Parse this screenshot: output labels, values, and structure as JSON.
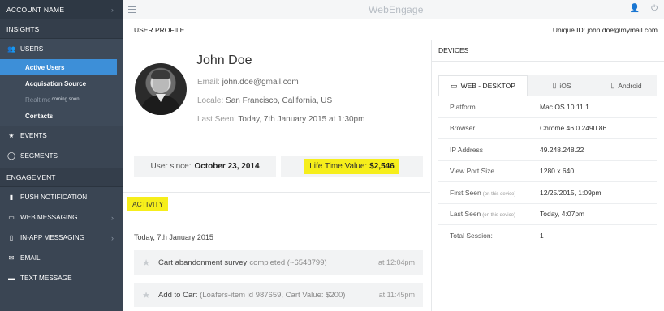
{
  "sidebar": {
    "account_name": "ACCOUNT NAME",
    "insights_label": "INSIGHTS",
    "users_label": "USERS",
    "users_sub": [
      {
        "label": "Active Users"
      },
      {
        "label": "Acquisation Source"
      },
      {
        "label": "Realtime",
        "badge": "coming soon"
      },
      {
        "label": "Contacts"
      }
    ],
    "events_label": "EVENTS",
    "segments_label": "SEGMENTS",
    "engagement_label": "ENGAGEMENT",
    "engagement_items": [
      {
        "label": "PUSH NOTIFICATION",
        "icon": "file-icon"
      },
      {
        "label": "WEB MESSAGING",
        "icon": "window-icon"
      },
      {
        "label": "IN-APP MESSAGING",
        "icon": "phone-icon"
      },
      {
        "label": "EMAIL",
        "icon": "envelope-icon"
      },
      {
        "label": "TEXT MESSAGE",
        "icon": "message-icon"
      }
    ]
  },
  "topbar": {
    "brand": "WebEngage"
  },
  "profile": {
    "section_title": "USER PROFILE",
    "unique_id_label": "Unique ID:",
    "unique_id": "john.doe@mymail.com",
    "name": "John Doe",
    "email_label": "Email:",
    "email": "john.doe@gmail.com",
    "locale_label": "Locale:",
    "locale": "San Francisco, California, US",
    "last_seen_label": "Last Seen:",
    "last_seen": "Today, 7th January 2015 at 1:30pm",
    "user_since_label": "User since:",
    "user_since": "October 23, 2014",
    "ltv_label": "Life Time Value:",
    "ltv": "$2,546"
  },
  "activity": {
    "tag": "ACTIVITY",
    "day": "Today, 7th January 2015",
    "items": [
      {
        "event": "Cart abandonment survey",
        "detail": "completed (~6548799)",
        "time": "at 12:04pm"
      },
      {
        "event": "Add to Cart",
        "detail": "(Loafers-item id 987659, Cart Value: $200)",
        "time": "at 11:45pm"
      }
    ]
  },
  "devices": {
    "title": "DEVICES",
    "tabs": [
      "WEB - DESKTOP",
      "iOS",
      "Android"
    ],
    "active_tab": "WEB - DESKTOP",
    "rows": [
      {
        "key": "Platform",
        "note": "",
        "value": "Mac OS 10.11.1"
      },
      {
        "key": "Browser",
        "note": "",
        "value": "Chrome 46.0.2490.86"
      },
      {
        "key": "IP Address",
        "note": "",
        "value": "49.248.248.22"
      },
      {
        "key": "View Port Size",
        "note": "",
        "value": "1280 x 640"
      },
      {
        "key": "First Seen",
        "note": "(on this device)",
        "value": "12/25/2015, 1:09pm"
      },
      {
        "key": "Last Seen",
        "note": "(on this device)",
        "value": "Today, 4:07pm"
      },
      {
        "key": "Total Session:",
        "note": "",
        "value": "1"
      }
    ]
  }
}
